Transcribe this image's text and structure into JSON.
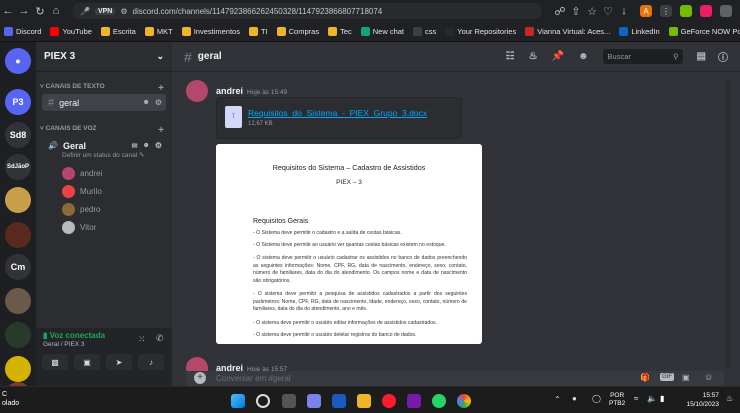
{
  "browser": {
    "url": "discord.com/channels/1147923866262450328/1147923866807718074",
    "vpn_label": "VPN",
    "profile_letter": "A"
  },
  "bookmarks": [
    {
      "label": "Discord",
      "color": "#5865f2"
    },
    {
      "label": "YouTube",
      "color": "#ff0000"
    },
    {
      "label": "Escrita",
      "color": "#f0b429"
    },
    {
      "label": "MKT",
      "color": "#f0b429"
    },
    {
      "label": "Investimentos",
      "color": "#f0b429"
    },
    {
      "label": "TI",
      "color": "#f0b429"
    },
    {
      "label": "Compras",
      "color": "#f0b429"
    },
    {
      "label": "Tec",
      "color": "#f0b429"
    },
    {
      "label": "New chat",
      "color": "#10a37f"
    },
    {
      "label": "css",
      "color": "#3c4043"
    },
    {
      "label": "Your Repositories",
      "color": "#24292f"
    },
    {
      "label": "Vianna Virtual: Aces...",
      "color": "#c62828"
    },
    {
      "label": "LinkedIn",
      "color": "#0a66c2"
    },
    {
      "label": "GeForce NOW Powe...",
      "color": "#76b900"
    }
  ],
  "servers": [
    {
      "label": "P3",
      "color": "#5865f2"
    },
    {
      "label": "Sd8",
      "color": "#313338"
    },
    {
      "label": "SdJãoP",
      "color": "#313338"
    },
    {
      "label": "",
      "color": "#c8a04a"
    },
    {
      "label": "",
      "color": "#5a2a20"
    },
    {
      "label": "Cm",
      "color": "#313338"
    },
    {
      "label": "",
      "color": "#6b5a4a"
    },
    {
      "label": "",
      "color": "#2a3a2a"
    },
    {
      "label": "",
      "color": "#d4b400"
    },
    {
      "label": "",
      "color": "#7a3a30"
    }
  ],
  "sidebar": {
    "server_name": "PIEX 3",
    "text_category": "CANAIS DE TEXTO",
    "text_channel": "geral",
    "voice_category": "CANAIS DE VOZ",
    "voice_channel": "Geral",
    "voice_status": "Definir um status do canal",
    "voice_users": [
      {
        "name": "andrei",
        "color": "#b5476a"
      },
      {
        "name": "Murilo",
        "color": "#ed4245"
      },
      {
        "name": "pedro",
        "color": "#8a6a3a"
      },
      {
        "name": "Vitor",
        "color": "#b5bac1"
      }
    ]
  },
  "voice_panel": {
    "status": "Voz conectada",
    "location": "Geral / PIEX 3"
  },
  "chat": {
    "channel": "geral",
    "search_placeholder": "Buscar",
    "message1": {
      "author": "andrei",
      "time": "Hoje às 15:49"
    },
    "attachment": {
      "name": "Requisitos_do_Sistema_-_PIEX_Grupo_3.docx",
      "size": "12,67 KB"
    },
    "message2": {
      "author": "andrei",
      "time": "Hoje às 15:57"
    },
    "composer_placeholder": "Conversar em #geral"
  },
  "document": {
    "title": "Requisitos do Sistema – Cadastro de Assistidos",
    "subtitle": "PIEX – 3",
    "heading": "Requisitos Gerais",
    "paragraphs": [
      "- O Sistema deve permitir o cadastro e a saída de cestas básicas.",
      "- O Sistema deve permitir ao usuário ver quantas cestas básicas existem no estoque.",
      "- O sistema deve permitir o usuário cadastrar os assistidos no banco de dados preenchendo as seguintes informações: Nome, CPF, RG, data de nascimento, endereço, sexo, contato, número de familiares, data do dia do atendimento. Os campos nome e data de nascimento são obrigatórios.",
      "- O sistema deve permitir a pesquisa de assistidos cadastrados a partir dos seguintes parâmetros: Nome, CPF, RG, data de nascimento, idade, endereço, sexo, contato, número de familiares, data do dia do atendimento, ano e mês.",
      "- O sistema deve permitir o usuário editar informações de assistidos cadastrados.",
      "- O sistema deve permitir o usuário deletar registros do banco de dados."
    ]
  },
  "taskbar": {
    "left_line1": "C",
    "left_line2": "olado",
    "lang1": "POR",
    "lang2": "PTB2",
    "time": "15:57",
    "date": "15/10/2023"
  }
}
